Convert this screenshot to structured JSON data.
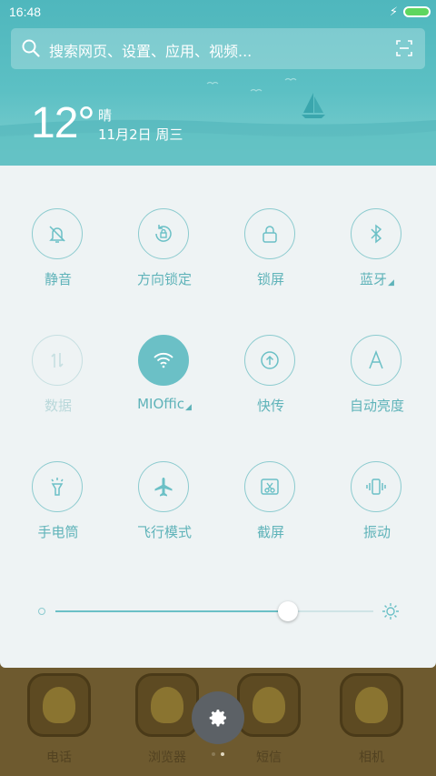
{
  "status_bar": {
    "time": "16:48",
    "battery_level": 1.0,
    "charging": true
  },
  "search": {
    "placeholder": "搜索网页、设置、应用、视频..."
  },
  "weather": {
    "temperature": "12°",
    "condition": "晴",
    "date": "11月2日 周三"
  },
  "quick_settings": {
    "tiles": [
      {
        "label": "静音",
        "icon": "bell-off-icon",
        "active": false,
        "enabled": true
      },
      {
        "label": "方向锁定",
        "icon": "rotation-lock-icon",
        "active": false,
        "enabled": true
      },
      {
        "label": "锁屏",
        "icon": "lock-icon",
        "active": false,
        "enabled": true
      },
      {
        "label": "蓝牙",
        "icon": "bluetooth-icon",
        "active": false,
        "enabled": true,
        "has_menu": true
      },
      {
        "label": "数据",
        "icon": "mobile-data-icon",
        "active": false,
        "enabled": false
      },
      {
        "label": "MIOffic",
        "icon": "wifi-icon",
        "active": true,
        "enabled": true,
        "has_menu": true
      },
      {
        "label": "快传",
        "icon": "share-transfer-icon",
        "active": false,
        "enabled": true
      },
      {
        "label": "自动亮度",
        "icon": "auto-brightness-icon",
        "active": false,
        "enabled": true
      },
      {
        "label": "手电筒",
        "icon": "flashlight-icon",
        "active": false,
        "enabled": true
      },
      {
        "label": "飞行模式",
        "icon": "airplane-icon",
        "active": false,
        "enabled": true
      },
      {
        "label": "截屏",
        "icon": "screenshot-icon",
        "active": false,
        "enabled": true
      },
      {
        "label": "振动",
        "icon": "vibrate-icon",
        "active": false,
        "enabled": true
      }
    ],
    "brightness": 0.73
  },
  "dock": {
    "apps": [
      {
        "label": "电话",
        "icon": "phone-app-icon"
      },
      {
        "label": "浏览器",
        "icon": "browser-app-icon"
      },
      {
        "label": "短信",
        "icon": "sms-app-icon"
      },
      {
        "label": "相机",
        "icon": "camera-app-icon"
      }
    ],
    "page_count": 2,
    "current_page": 2
  },
  "colors": {
    "accent": "#6bc0c6",
    "tile_border": "#8ccbcf",
    "label": "#5fb3b9",
    "panel_bg": "#eef3f4",
    "header_bg": "#5cc0c4"
  }
}
